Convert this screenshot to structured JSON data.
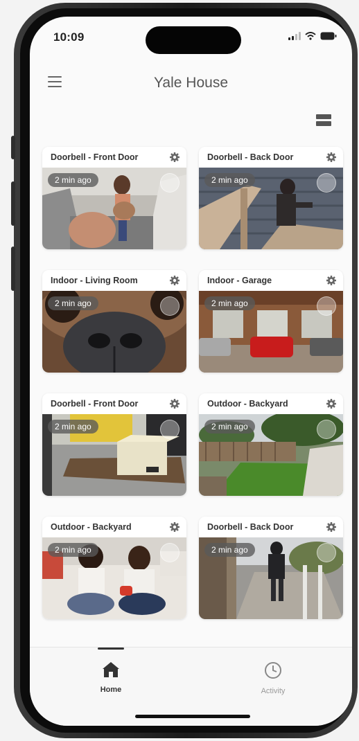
{
  "status_bar": {
    "time": "10:09"
  },
  "header": {
    "title": "Yale House"
  },
  "cameras": [
    {
      "label": "Doorbell - Front Door",
      "age": "2 min ago"
    },
    {
      "label": "Doorbell - Back Door",
      "age": "2 min ago"
    },
    {
      "label": "Indoor - Living Room",
      "age": "2 min ago"
    },
    {
      "label": "Indoor - Garage",
      "age": "2 min ago"
    },
    {
      "label": "Doorbell - Front Door",
      "age": "2 min ago"
    },
    {
      "label": "Outdoor - Backyard",
      "age": "2 min ago"
    },
    {
      "label": "Outdoor - Backyard",
      "age": "2 min ago"
    },
    {
      "label": "Doorbell - Back Door",
      "age": "2 min ago"
    }
  ],
  "tabs": [
    {
      "label": "Home",
      "icon": "home-icon",
      "active": true
    },
    {
      "label": "Activity",
      "icon": "clock-icon",
      "active": false
    }
  ],
  "colors": {
    "active_tab": "#333333",
    "inactive_tab": "#999999",
    "pill": "#5a5a5a"
  }
}
